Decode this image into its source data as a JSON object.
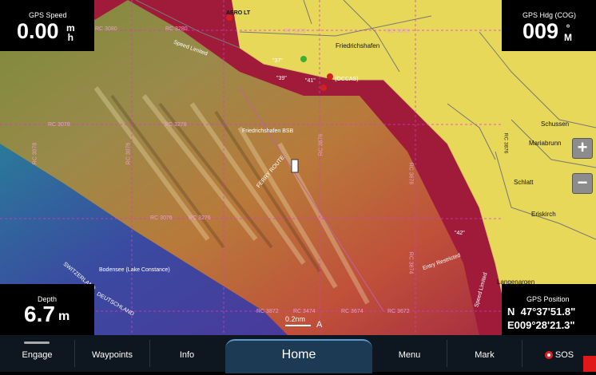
{
  "map": {
    "place_labels": {
      "aero_lt": "AERO LT",
      "friedrichshafen": "Friedrichshafen",
      "schussen": "Schussen",
      "mariabrunn": "Mariabrunn",
      "schlatt": "Schlatt",
      "eriskirch": "Eriskirch",
      "langenargen": "Langenargen",
      "bodensee": "Bodensee (Lake Constance)",
      "deutschland": "DEUTSCHLAND",
      "schweiz": "SWITZERLAND",
      "friedrichshafen_bsb": "Friedrichshafen BSB",
      "ferry_route": "FERRY ROUTE",
      "speed_limited_1": "Speed Limited",
      "speed_limited_2": "Speed Limited",
      "entry_restricted": "Entry Restricted",
      "occas": "(OCCAS)",
      "buoy_37": "\"37\"",
      "buoy_39": "\"39\"",
      "buoy_41": "\"41\"",
      "buoy_42": "\"42\""
    },
    "route_labels": [
      "RC 3080",
      "RC 3280",
      "RC 3478",
      "RC 3678",
      "RC 3078",
      "RC 3278",
      "RC 3876",
      "RC 3076",
      "RC 3276",
      "RC 3274",
      "RC 3676",
      "RC 3674",
      "RC 3872",
      "RC 3474",
      "RC 3674",
      "RC 3672",
      "RC 3876",
      "RC 3078",
      "RC 3076"
    ],
    "scale": {
      "value": "0.2nm",
      "letter": "A"
    },
    "colors": {
      "land": "#e8d85a",
      "deep_red": "#a01a3a",
      "shallow": "#c8403c",
      "deep_blue": "#3a3a9a",
      "grid": "#d040c0"
    }
  },
  "frames": {
    "gps_speed": {
      "title": "GPS Speed",
      "value": "0.00",
      "unit_top": "m",
      "unit_bottom": "h"
    },
    "gps_hdg": {
      "title": "GPS Hdg (COG)",
      "value": "009",
      "unit_top": "°",
      "unit_bottom": "M"
    },
    "depth": {
      "title": "Depth",
      "value": "6.7",
      "unit": "m"
    },
    "gps_position": {
      "title": "GPS Position",
      "lat": "N  47°37'51.8\"",
      "lon": "E009°28'21.3\""
    }
  },
  "zoom": {
    "in_symbol": "+",
    "out_symbol": "−"
  },
  "bottom_bar": {
    "engage": "Engage",
    "waypoints": "Waypoints",
    "info": "Info",
    "home": "Home",
    "menu": "Menu",
    "mark": "Mark",
    "sos": "SOS"
  }
}
